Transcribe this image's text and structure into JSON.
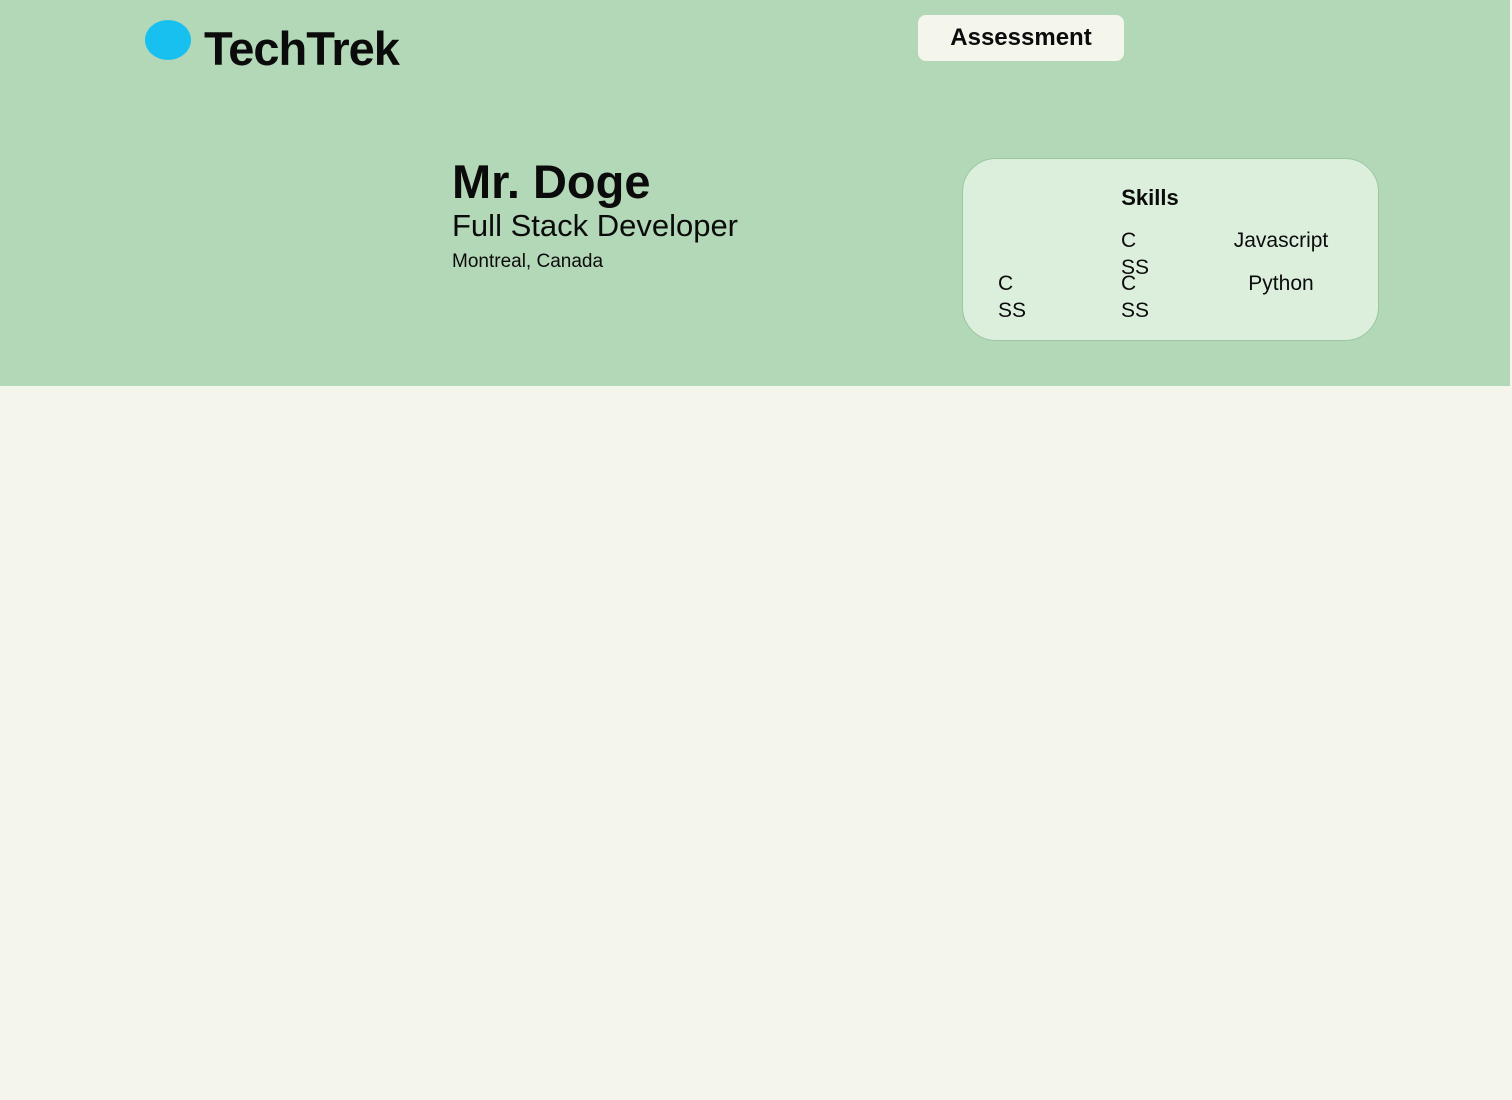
{
  "brand": {
    "name": "TechTrek",
    "logo_icon": "circle-logo-icon",
    "logo_color": "#18c0ef"
  },
  "nav": {
    "assessment_label": "Assessment"
  },
  "profile": {
    "name": "Mr. Doge",
    "title": "Full Stack Developer",
    "location": "Montreal, Canada"
  },
  "skills": {
    "title": "Skills",
    "items": [
      "CSS",
      "Javascript",
      "CSS",
      "CSS",
      "Python"
    ]
  },
  "colors": {
    "header_bg": "#b3d8b7",
    "page_bg": "#f4f6eb",
    "card_bg": "#dcefdd"
  }
}
